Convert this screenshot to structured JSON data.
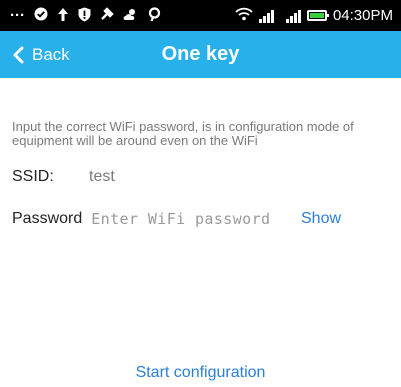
{
  "status_bar": {
    "icons": [
      "more-icon",
      "check-circle-icon",
      "upload-arrow-icon",
      "shield-alert-icon",
      "tools-icon",
      "weather-icon",
      "search-icon",
      "wifi-icon",
      "signal-icon",
      "signal-icon-2",
      "battery-icon"
    ],
    "time": "04:30PM"
  },
  "header": {
    "back_label": "Back",
    "title": "One key",
    "color": "#27b0ea"
  },
  "form": {
    "hint": "Input the correct WiFi password, is in configuration mode of equipment will be around even on the WiFi",
    "ssid_label": "SSID:",
    "ssid_value": "test",
    "password_label": "Password",
    "password_placeholder": "Enter WiFi password",
    "password_value": "",
    "show_label": "Show"
  },
  "actions": {
    "start_label": "Start configuration"
  }
}
